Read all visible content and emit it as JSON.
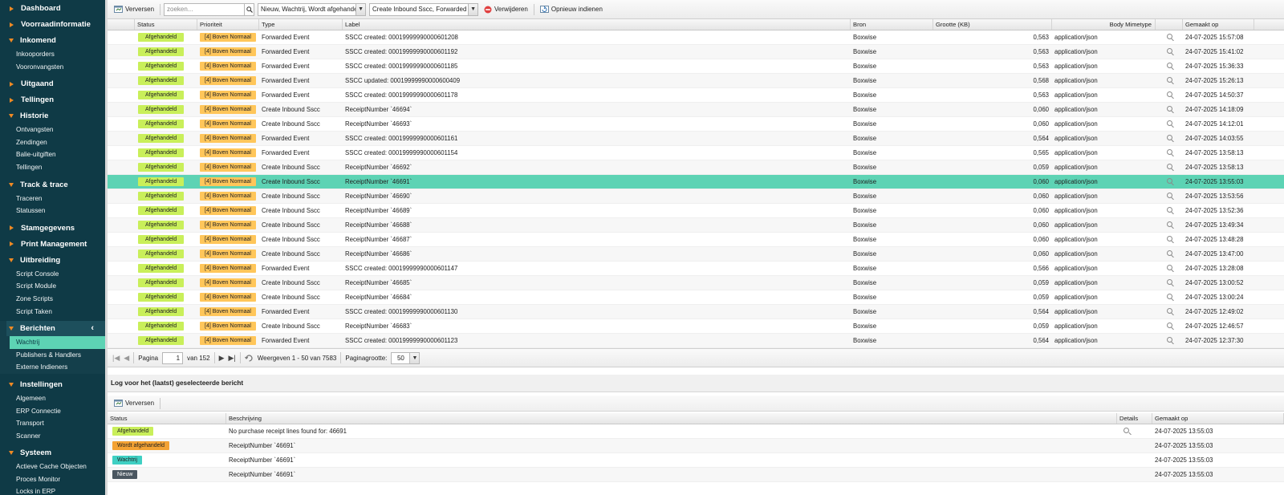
{
  "sidebar": {
    "sections": [
      {
        "label": "Dashboard",
        "open": false,
        "items": []
      },
      {
        "label": "Voorraadinformatie",
        "open": false,
        "items": []
      },
      {
        "label": "Inkomend",
        "open": true,
        "items": [
          "Inkooporders",
          "Vooronvangsten"
        ]
      },
      {
        "label": "Uitgaand",
        "open": false,
        "items": []
      },
      {
        "label": "Tellingen",
        "open": false,
        "items": []
      },
      {
        "label": "Historie",
        "open": true,
        "items": [
          "Ontvangsten",
          "Zendingen",
          "Balie-uitgiften",
          "Tellingen"
        ]
      },
      {
        "label": "Track & trace",
        "open": true,
        "items": [
          "Traceren",
          "Statussen"
        ]
      },
      {
        "label": "Stamgegevens",
        "open": false,
        "items": []
      },
      {
        "label": "Print Management",
        "open": false,
        "items": []
      },
      {
        "label": "Uitbreiding",
        "open": true,
        "items": [
          "Script Console",
          "Script Module",
          "Zone Scripts",
          "Script Taken"
        ]
      },
      {
        "label": "Berichten",
        "open": true,
        "items": [
          "Wachtrij",
          "Publishers & Handlers",
          "Externe Indieners"
        ],
        "active_item": "Wachtrij"
      },
      {
        "label": "Instellingen",
        "open": true,
        "items": [
          "Algemeen",
          "ERP Connectie",
          "Transport",
          "Scanner"
        ]
      },
      {
        "label": "Systeem",
        "open": true,
        "items": [
          "Actieve Cache Objecten",
          "Proces Monitor",
          "Locks in ERP"
        ]
      }
    ]
  },
  "toolbar": {
    "refresh_label": "Verversen",
    "search_placeholder": "zoeken...",
    "status_filter": "Nieuw, Wachtrij, Wordt afgehandeld",
    "type_filter": "Create Inbound Sscc, Forwarded Event",
    "delete_label": "Verwijderen",
    "resubmit_label": "Opnieuw indienen"
  },
  "grid": {
    "columns": [
      "Status",
      "Prioriteit",
      "Type",
      "Label",
      "Bron",
      "Grootte (KB)",
      "Body Mimetype",
      "Gemaakt op"
    ],
    "rows": [
      {
        "status": "Afgehandeld",
        "priority": "[4] Boven Normaal",
        "type": "Forwarded Event",
        "label": "SSCC created: 00019999990000601208",
        "source": "Boxwise",
        "size": "0,563",
        "mime": "application/json",
        "created": "24-07-2025 15:57:08"
      },
      {
        "status": "Afgehandeld",
        "priority": "[4] Boven Normaal",
        "type": "Forwarded Event",
        "label": "SSCC created: 00019999990000601192",
        "source": "Boxwise",
        "size": "0,563",
        "mime": "application/json",
        "created": "24-07-2025 15:41:02"
      },
      {
        "status": "Afgehandeld",
        "priority": "[4] Boven Normaal",
        "type": "Forwarded Event",
        "label": "SSCC created: 00019999990000601185",
        "source": "Boxwise",
        "size": "0,563",
        "mime": "application/json",
        "created": "24-07-2025 15:36:33"
      },
      {
        "status": "Afgehandeld",
        "priority": "[4] Boven Normaal",
        "type": "Forwarded Event",
        "label": "SSCC updated: 00019999990000600409",
        "source": "Boxwise",
        "size": "0,568",
        "mime": "application/json",
        "created": "24-07-2025 15:26:13"
      },
      {
        "status": "Afgehandeld",
        "priority": "[4] Boven Normaal",
        "type": "Forwarded Event",
        "label": "SSCC created: 00019999990000601178",
        "source": "Boxwise",
        "size": "0,563",
        "mime": "application/json",
        "created": "24-07-2025 14:50:37"
      },
      {
        "status": "Afgehandeld",
        "priority": "[4] Boven Normaal",
        "type": "Create Inbound Sscc",
        "label": "ReceiptNumber `46694`",
        "source": "Boxwise",
        "size": "0,060",
        "mime": "application/json",
        "created": "24-07-2025 14:18:09"
      },
      {
        "status": "Afgehandeld",
        "priority": "[4] Boven Normaal",
        "type": "Create Inbound Sscc",
        "label": "ReceiptNumber `46693`",
        "source": "Boxwise",
        "size": "0,060",
        "mime": "application/json",
        "created": "24-07-2025 14:12:01"
      },
      {
        "status": "Afgehandeld",
        "priority": "[4] Boven Normaal",
        "type": "Forwarded Event",
        "label": "SSCC created: 00019999990000601161",
        "source": "Boxwise",
        "size": "0,564",
        "mime": "application/json",
        "created": "24-07-2025 14:03:55"
      },
      {
        "status": "Afgehandeld",
        "priority": "[4] Boven Normaal",
        "type": "Forwarded Event",
        "label": "SSCC created: 00019999990000601154",
        "source": "Boxwise",
        "size": "0,565",
        "mime": "application/json",
        "created": "24-07-2025 13:58:13"
      },
      {
        "status": "Afgehandeld",
        "priority": "[4] Boven Normaal",
        "type": "Create Inbound Sscc",
        "label": "ReceiptNumber `46692`",
        "source": "Boxwise",
        "size": "0,059",
        "mime": "application/json",
        "created": "24-07-2025 13:58:13"
      },
      {
        "status": "Afgehandeld",
        "priority": "[4] Boven Normaal",
        "type": "Create Inbound Sscc",
        "label": "ReceiptNumber `46691`",
        "source": "Boxwise",
        "size": "0,060",
        "mime": "application/json",
        "created": "24-07-2025 13:55:03",
        "selected": true
      },
      {
        "status": "Afgehandeld",
        "priority": "[4] Boven Normaal",
        "type": "Create Inbound Sscc",
        "label": "ReceiptNumber `46690`",
        "source": "Boxwise",
        "size": "0,060",
        "mime": "application/json",
        "created": "24-07-2025 13:53:56"
      },
      {
        "status": "Afgehandeld",
        "priority": "[4] Boven Normaal",
        "type": "Create Inbound Sscc",
        "label": "ReceiptNumber `46689`",
        "source": "Boxwise",
        "size": "0,060",
        "mime": "application/json",
        "created": "24-07-2025 13:52:36"
      },
      {
        "status": "Afgehandeld",
        "priority": "[4] Boven Normaal",
        "type": "Create Inbound Sscc",
        "label": "ReceiptNumber `46688`",
        "source": "Boxwise",
        "size": "0,060",
        "mime": "application/json",
        "created": "24-07-2025 13:49:34"
      },
      {
        "status": "Afgehandeld",
        "priority": "[4] Boven Normaal",
        "type": "Create Inbound Sscc",
        "label": "ReceiptNumber `46687`",
        "source": "Boxwise",
        "size": "0,060",
        "mime": "application/json",
        "created": "24-07-2025 13:48:28"
      },
      {
        "status": "Afgehandeld",
        "priority": "[4] Boven Normaal",
        "type": "Create Inbound Sscc",
        "label": "ReceiptNumber `46686`",
        "source": "Boxwise",
        "size": "0,060",
        "mime": "application/json",
        "created": "24-07-2025 13:47:00"
      },
      {
        "status": "Afgehandeld",
        "priority": "[4] Boven Normaal",
        "type": "Forwarded Event",
        "label": "SSCC created: 00019999990000601147",
        "source": "Boxwise",
        "size": "0,566",
        "mime": "application/json",
        "created": "24-07-2025 13:28:08"
      },
      {
        "status": "Afgehandeld",
        "priority": "[4] Boven Normaal",
        "type": "Create Inbound Sscc",
        "label": "ReceiptNumber `46685`",
        "source": "Boxwise",
        "size": "0,059",
        "mime": "application/json",
        "created": "24-07-2025 13:00:52"
      },
      {
        "status": "Afgehandeld",
        "priority": "[4] Boven Normaal",
        "type": "Create Inbound Sscc",
        "label": "ReceiptNumber `46684`",
        "source": "Boxwise",
        "size": "0,059",
        "mime": "application/json",
        "created": "24-07-2025 13:00:24"
      },
      {
        "status": "Afgehandeld",
        "priority": "[4] Boven Normaal",
        "type": "Forwarded Event",
        "label": "SSCC created: 00019999990000601130",
        "source": "Boxwise",
        "size": "0,564",
        "mime": "application/json",
        "created": "24-07-2025 12:49:02"
      },
      {
        "status": "Afgehandeld",
        "priority": "[4] Boven Normaal",
        "type": "Create Inbound Sscc",
        "label": "ReceiptNumber `46683`",
        "source": "Boxwise",
        "size": "0,059",
        "mime": "application/json",
        "created": "24-07-2025 12:46:57"
      },
      {
        "status": "Afgehandeld",
        "priority": "[4] Boven Normaal",
        "type": "Forwarded Event",
        "label": "SSCC created: 00019999990000601123",
        "source": "Boxwise",
        "size": "0,564",
        "mime": "application/json",
        "created": "24-07-2025 12:37:30"
      }
    ]
  },
  "pager": {
    "page_label": "Pagina",
    "page_value": "1",
    "of_label": "van 152",
    "display_label": "Weergeven 1 - 50 van 7583",
    "page_size_label": "Paginagrootte:",
    "page_size_value": "50"
  },
  "log": {
    "title": "Log voor het (laatst) geselecteerde bericht",
    "refresh_label": "Verversen",
    "columns": [
      "Status",
      "Beschrijving",
      "Details",
      "Gemaakt op"
    ],
    "rows": [
      {
        "status": "Afgehandeld",
        "status_color": "#c9ef5a",
        "description": "No purchase receipt lines found for: 46691",
        "has_details": true,
        "created": "24-07-2025 13:55:03"
      },
      {
        "status": "Wordt afgehandeld",
        "status_color": "#f3a234",
        "description": "ReceiptNumber `46691`",
        "has_details": false,
        "created": "24-07-2025 13:55:03"
      },
      {
        "status": "Wachtrij",
        "status_color": "#3fd0c3",
        "description": "ReceiptNumber `46691`",
        "has_details": false,
        "created": "24-07-2025 13:55:03"
      },
      {
        "status": "Nieuw",
        "status_color": "#4a5660",
        "description": "ReceiptNumber `46691`",
        "has_details": false,
        "created": "24-07-2025 13:55:03"
      }
    ]
  },
  "colors": {
    "sidebar_bg": "#0f3a46",
    "accent_orange": "#f08a24",
    "selected_row": "#5dd3b4",
    "status_done": "#c9ef5a",
    "priority_above_normal": "#ffc65a"
  }
}
